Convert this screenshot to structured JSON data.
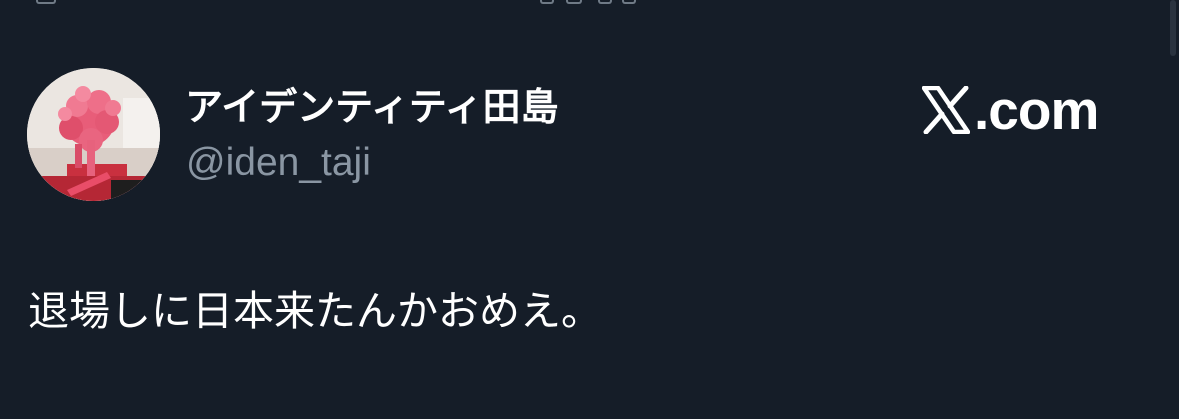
{
  "tweet": {
    "author": {
      "display_name": "アイデンティティ田島",
      "handle": "@iden_taji",
      "avatar_icon": "profile-avatar-pink-knot"
    },
    "brand": {
      "icon": "x-logo-icon",
      "domain_label": ".com"
    },
    "body_text": "退場しに日本来たんかおめえ。"
  },
  "colors": {
    "background": "#151d28",
    "primary_text": "#ffffff",
    "secondary_text": "#8a96a3"
  }
}
